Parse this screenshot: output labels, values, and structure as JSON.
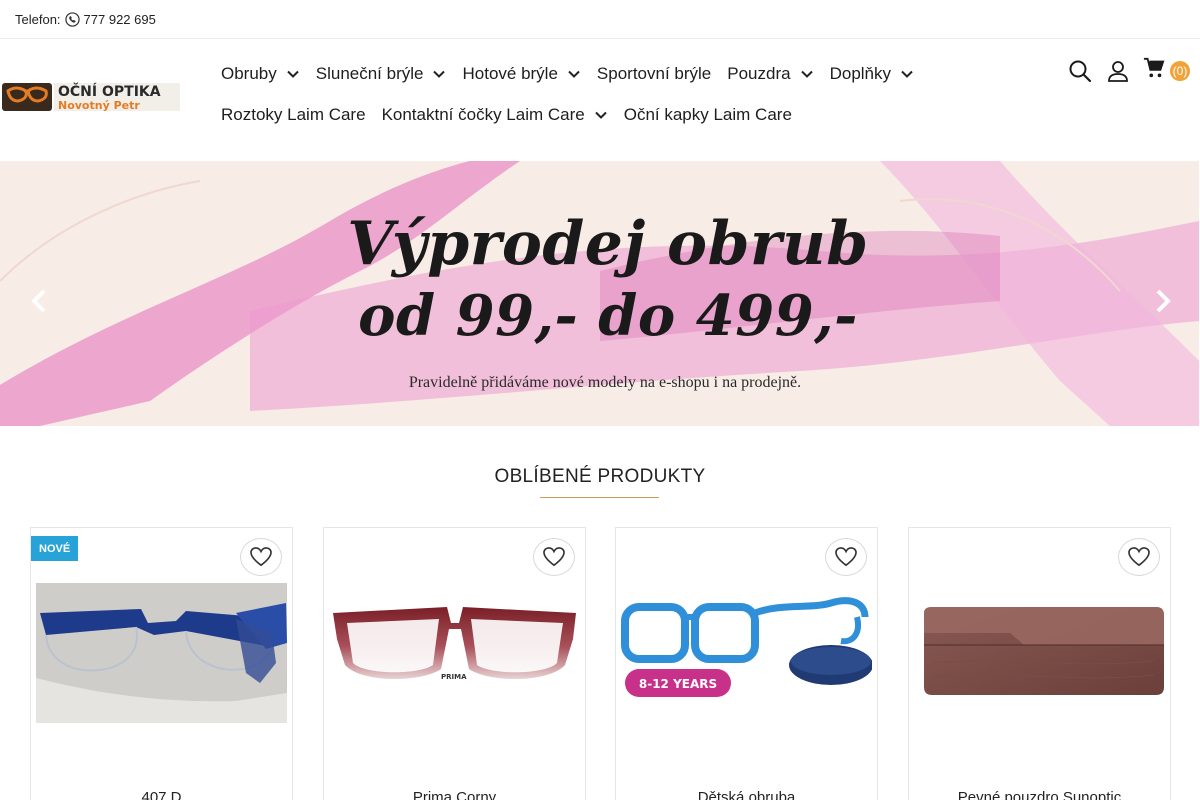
{
  "topbar": {
    "phone_label": "Telefon:",
    "phone_icon": "phone-icon",
    "phone_number": "777 922 695"
  },
  "logo": {
    "line1": "OČNÍ OPTIKA",
    "line2": "Novotný Petr"
  },
  "nav": {
    "row1": [
      {
        "label": "Obruby",
        "has_dropdown": true
      },
      {
        "label": "Sluneční brýle",
        "has_dropdown": true
      },
      {
        "label": "Hotové brýle",
        "has_dropdown": true
      },
      {
        "label": "Sportovní brýle",
        "has_dropdown": false
      },
      {
        "label": "Pouzdra",
        "has_dropdown": true
      },
      {
        "label": "Doplňky",
        "has_dropdown": true
      }
    ],
    "row2": [
      {
        "label": "Roztoky Laim Care",
        "has_dropdown": false
      },
      {
        "label": "Kontaktní čočky Laim Care",
        "has_dropdown": true
      },
      {
        "label": "Oční kapky Laim Care",
        "has_dropdown": false
      }
    ]
  },
  "header_icons": {
    "search_icon": "search-icon",
    "account_icon": "user-icon",
    "cart_icon": "cart-icon",
    "cart_count": "(0)"
  },
  "hero": {
    "line1": "Výprodej obrub",
    "line2": "od 99,- do 499,-",
    "subtitle": "Pravidelně přidáváme nové modely na e-shopu i na prodejně.",
    "prev_icon": "chevron-left-icon",
    "next_icon": "chevron-right-icon"
  },
  "section": {
    "title": "OBLÍBENÉ PRODUKTY"
  },
  "products": [
    {
      "name": "407 D",
      "badge": "NOVÉ",
      "image": "blue-half-rim-glasses"
    },
    {
      "name": "Prima Corny",
      "badge": "",
      "image": "brown-gradient-glasses",
      "image_text": "PRIMA"
    },
    {
      "name": "Dětská obruba",
      "badge": "",
      "image": "blue-kids-glasses-with-case",
      "image_text": "8-12 YEARS"
    },
    {
      "name": "Pevné pouzdro Sunoptic",
      "badge": "",
      "image": "wooden-glasses-case"
    }
  ],
  "colors": {
    "accent": "#c79d5a",
    "cart_badge": "#f1a33a",
    "badge_new": "#27a3d8",
    "hero_bg": "#f6ebe6",
    "hero_brush": "#e88fc6"
  }
}
